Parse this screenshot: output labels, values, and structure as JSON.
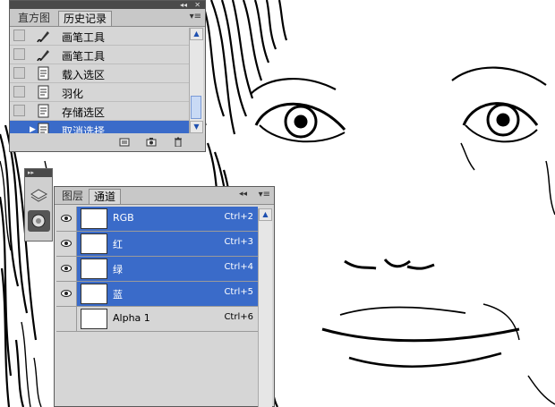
{
  "history_panel": {
    "tabs": [
      "直方图",
      "历史记录"
    ],
    "active_tab": 1,
    "collapse_glyph": "◂◂",
    "close_glyph": "✕",
    "menu_glyph": "▾≡",
    "items": [
      {
        "label": "画笔工具",
        "icon": "brush-icon",
        "selected": false
      },
      {
        "label": "画笔工具",
        "icon": "brush-icon",
        "selected": false
      },
      {
        "label": "载入选区",
        "icon": "history-state-icon",
        "selected": false
      },
      {
        "label": "羽化",
        "icon": "history-state-icon",
        "selected": false
      },
      {
        "label": "存储选区",
        "icon": "history-state-icon",
        "selected": false
      },
      {
        "label": "取消选择",
        "icon": "history-state-icon",
        "selected": true
      }
    ],
    "bottom_icons": [
      "new-document-icon",
      "snapshot-icon",
      "trash-icon"
    ]
  },
  "dock": {
    "expand_glyph": "▸▸",
    "icons": [
      "layers-icon",
      "channels-icon"
    ]
  },
  "channels_panel": {
    "tabs": [
      "图层",
      "通道"
    ],
    "active_tab": 1,
    "collapse_glyph": "◂◂",
    "menu_glyph": "▾≡",
    "channels": [
      {
        "name": "RGB",
        "shortcut": "Ctrl+2",
        "visible": true,
        "selected": true
      },
      {
        "name": "红",
        "shortcut": "Ctrl+3",
        "visible": true,
        "selected": true
      },
      {
        "name": "绿",
        "shortcut": "Ctrl+4",
        "visible": true,
        "selected": true
      },
      {
        "name": "蓝",
        "shortcut": "Ctrl+5",
        "visible": true,
        "selected": true
      },
      {
        "name": "Alpha 1",
        "shortcut": "Ctrl+6",
        "visible": false,
        "selected": false
      }
    ]
  },
  "colors": {
    "selection": "#3a6bc9",
    "panel_bg": "#d6d6d6",
    "title_bar": "#4a4a4a"
  }
}
